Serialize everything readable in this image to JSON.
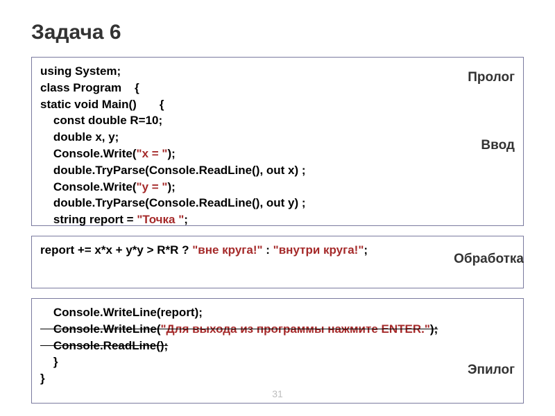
{
  "title": "Задача 6",
  "labels": {
    "prolog": "Пролог",
    "input": "Ввод",
    "process": "Обработка",
    "epilog": "Эпилог"
  },
  "code": {
    "b1_l1": "using System;",
    "b1_l2": "class Program    {",
    "b1_l3": "static void Main()       {",
    "b1_l4": "    const double R=10;",
    "b1_l5": "    double x, y;",
    "b1_l6a": "    Console.Write(",
    "b1_l6s": "\"x = \"",
    "b1_l6b": ");",
    "b1_l7": "    double.TryParse(Console.ReadLine(), out x) ;",
    "b1_l8a": "    Console.Write(",
    "b1_l8s": "\"y = \"",
    "b1_l8b": ");",
    "b1_l9": "    double.TryParse(Console.ReadLine(), out y) ;",
    "b1_l10a": "    string report = ",
    "b1_l10s": "\"Точка \"",
    "b1_l10b": ";",
    "b2_l1a": "report += x*x + y*y > R*R ? ",
    "b2_l1s1": "\"вне круга!\"",
    "b2_l1m": " : ",
    "b2_l1s2": "\"внутри круга!\"",
    "b2_l1b": ";",
    "b3_l1": "    Console.WriteLine(report);",
    "b3_l2a": "    Console.WriteLine(",
    "b3_l2s": "\"Для выхода из программы нажмите ENTER.\"",
    "b3_l2b": ");",
    "b3_l3": "    Console.ReadLine();",
    "b3_l4": "    }",
    "b3_l5": "}"
  },
  "page": "31"
}
